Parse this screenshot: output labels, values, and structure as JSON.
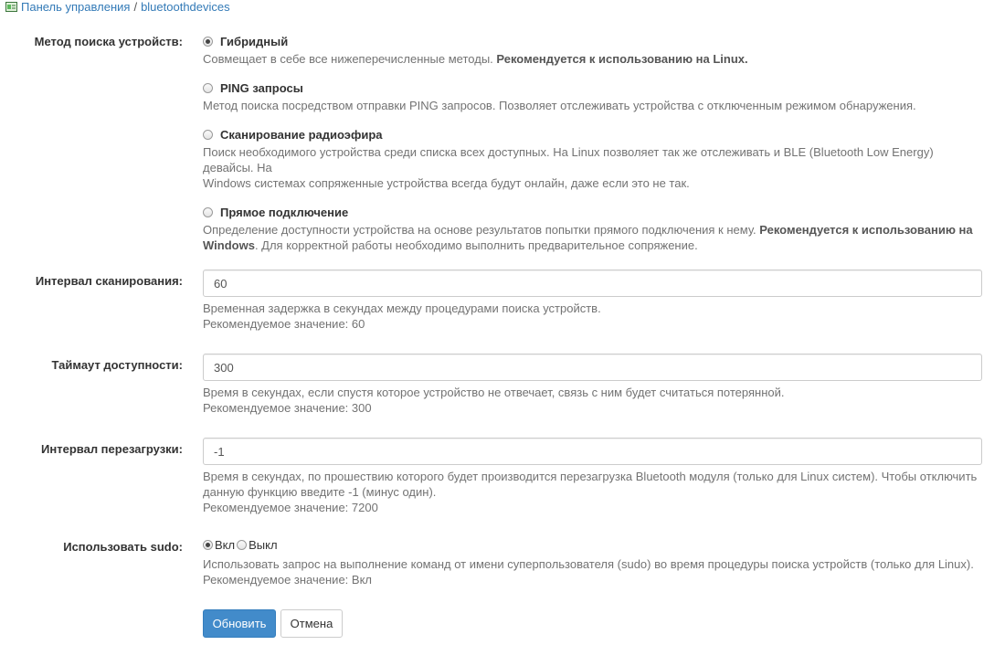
{
  "breadcrumb": {
    "root": "Панель управления",
    "separator": "/",
    "current": "bluetoothdevices"
  },
  "search_method": {
    "label": "Метод поиска устройств:",
    "options": [
      {
        "label": "Гибридный",
        "checked": true,
        "help": "Совмещает в себе все нижеперечисленные методы. ",
        "help_bold": "Рекомендуется к использованию на Linux."
      },
      {
        "label": "PING запросы",
        "checked": false,
        "help": "Метод поиска посредством отправки PING запросов. Позволяет отслеживать устройства с отключенным режимом обнаружения."
      },
      {
        "label": "Сканирование радиоэфира",
        "checked": false,
        "help_line1": "Поиск необходимого устройства среди списка всех доступных. На Linux позволяет так же отслеживать и BLE (Bluetooth Low Energy) девайсы. На",
        "help_line2": "Windows системах сопряженные устройства всегда будут онлайн, даже если это не так."
      },
      {
        "label": "Прямое подключение",
        "checked": false,
        "help_part1": "Определение доступности устройства на основе результатов попытки прямого подключения к нему. ",
        "help_bold1": "Рекомендуется к использованию на",
        "help_bold2": "Windows",
        "help_part2": ". Для корректной работы необходимо выполнить предварительное сопряжение."
      }
    ]
  },
  "scan_interval": {
    "label": "Интервал сканирования:",
    "value": "60",
    "help": "Временная задержка в секундах между процедурами поиска устройств.",
    "recommended": "Рекомендуемое значение: 60"
  },
  "availability_timeout": {
    "label": "Таймаут доступности:",
    "value": "300",
    "help": "Время в секундах, если спустя которое устройство не отвечает, связь с ним будет считаться потерянной.",
    "recommended": "Рекомендуемое значение: 300"
  },
  "reset_interval": {
    "label": "Интервал перезагрузки:",
    "value": "-1",
    "help_line1": "Время в секундах, по прошествию которого будет производится перезагрузка Bluetooth модуля (только для Linux систем). Чтобы отключить",
    "help_line2": "данную функцию введите -1 (минус один).",
    "recommended": "Рекомендуемое значение: 7200"
  },
  "use_sudo": {
    "label": "Использовать sudo:",
    "on_label": "Вкл",
    "off_label": "Выкл",
    "on_checked": true,
    "help": "Использовать запрос на выполнение команд от имени суперпользователя (sudo) во время процедуры поиска устройств (только для Linux).",
    "recommended": "Рекомендуемое значение: Вкл"
  },
  "buttons": {
    "update": "Обновить",
    "cancel": "Отмена"
  },
  "colors": {
    "link": "#337ab7",
    "primary": "#428bca",
    "help_text": "#737373"
  }
}
